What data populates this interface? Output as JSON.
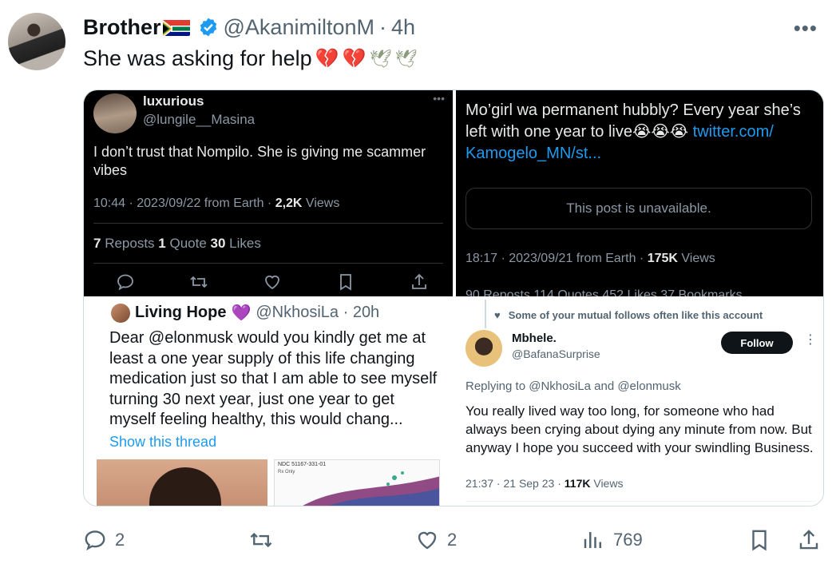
{
  "tweet": {
    "author_name": "Brother",
    "handle": "@AkanimiltonM",
    "separator": "·",
    "time": "4h",
    "text": "She was asking for help",
    "more_icon": "more-dots-icon",
    "emojis": [
      "broken-heart",
      "broken-heart",
      "dove",
      "dove"
    ]
  },
  "quoted_top_left": {
    "name": "luxurious",
    "handle": "@lungile__Masina",
    "dots": "•••",
    "text": "I don’t trust that Nompilo. She is giving me scammer vibes",
    "meta_prefix": "10:44 · 2023/09/22 from Earth · ",
    "views_count": "2,2K",
    "views_label": " Views",
    "reposts_count": "7",
    "reposts_label": " Reposts ",
    "quotes_count": "1",
    "quotes_label": " Quote ",
    "likes_count": "30",
    "likes_label": " Likes"
  },
  "quoted_top_right": {
    "text_1": "Mo’girl wa permanent hubbly? Every year she’s left with one year to live",
    "text_emojis": "😭😭😭",
    "link": "twitter.com/ Kamogelo_MN/st...",
    "unavailable": "This post is unavailable.",
    "meta_prefix": "18:17 · 2023/09/21 from Earth · ",
    "views_count": "175K",
    "views_label": " Views",
    "stats_cut": "90 Reposts   114 Quotes   452 Likes   37 Bookmarks"
  },
  "quoted_bottom_left": {
    "name": "Living Hope",
    "heart": "💜",
    "handle_time": "@NkhosiLa · 20h",
    "text": "Dear @elonmusk would you kindly get me at least a one year supply of this life changing medication just so that I am able to see myself turning 30 next year, just one year to get myself feeling healthy, this would chang...",
    "show_thread": "Show this thread",
    "box_ndc": "NDC 51167-331-01",
    "box_rx": "Rx Only"
  },
  "quoted_bottom_right": {
    "mutual_note": "Some of your mutual follows often like this account",
    "name": "Mbhele.",
    "handle": "@BafanaSurprise",
    "follow_label": "Follow",
    "dots": "⋮",
    "replying": "Replying to @NkhosiLa and @elonmusk",
    "text": "You really lived way too long, for someone who had always been crying about dying any minute from now. But anyway I hope you succeed with your swindling Business.",
    "meta_prefix": "21:37 · 21 Sep 23 · ",
    "views_count": "117K",
    "views_label": " Views"
  },
  "actions": {
    "replies": "2",
    "likes": "2",
    "views": "769"
  },
  "colors": {
    "accent": "#1d9bf0",
    "text": "#0f1419",
    "muted": "#536471",
    "dark_bg": "#000000"
  }
}
